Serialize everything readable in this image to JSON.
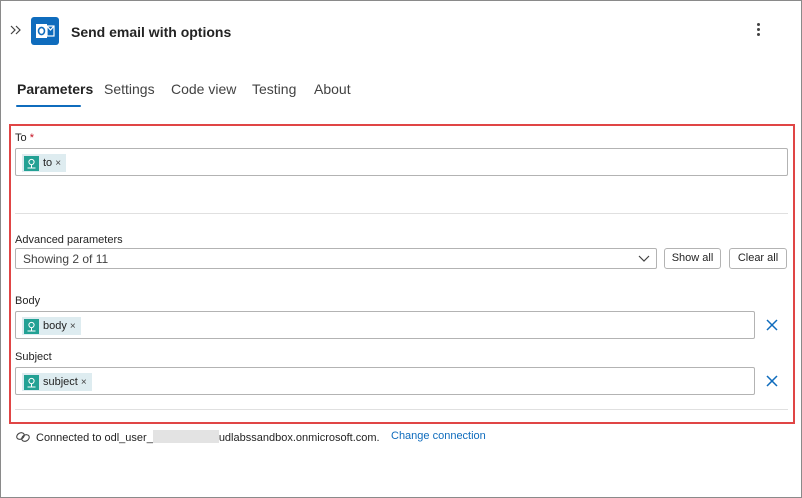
{
  "header": {
    "title": "Send email with options",
    "app_icon": "outlook-icon",
    "collapse_icon": "chevron-double-right-icon",
    "more_icon": "more-vertical-icon"
  },
  "tabs": [
    {
      "label": "Parameters",
      "active": true
    },
    {
      "label": "Settings",
      "active": false
    },
    {
      "label": "Code view",
      "active": false
    },
    {
      "label": "Testing",
      "active": false
    },
    {
      "label": "About",
      "active": false
    }
  ],
  "params": {
    "to": {
      "label": "To",
      "required_mark": "*",
      "token": "to"
    },
    "advanced": {
      "label": "Advanced parameters",
      "selected": "Showing 2 of 11",
      "show_all_label": "Show all",
      "clear_all_label": "Clear all"
    },
    "body": {
      "label": "Body",
      "token": "body"
    },
    "subject": {
      "label": "Subject",
      "token": "subject"
    },
    "token_remove": "×"
  },
  "connection": {
    "prefix": "Connected to odl_user_",
    "suffix": "udlabssandbox.onmicrosoft.com.",
    "change_label": "Change connection"
  },
  "colors": {
    "accent": "#0f6cbd",
    "highlight_border": "#e04545",
    "token_bg": "#deecf0",
    "token_icon": "#23a194",
    "required": "#c50f1f"
  }
}
